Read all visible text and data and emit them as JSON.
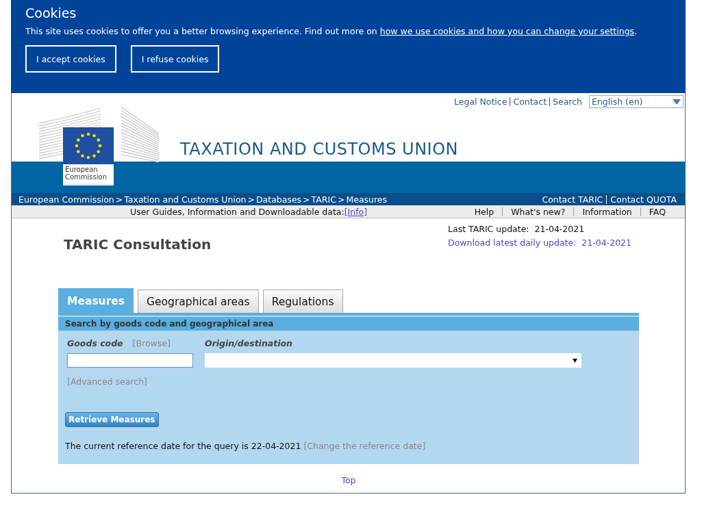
{
  "cookie_banner": {
    "title": "Cookies",
    "message": "This site uses cookies to offer you a better browsing experience. Find out more on",
    "link": "how we use cookies and how you can change your settings",
    "message_end": ".",
    "buttons": [
      "I accept cookies",
      "I refuse cookies"
    ]
  },
  "header": {
    "top_links": [
      "Legal Notice",
      "Contact",
      "Search"
    ],
    "language": "English (en)",
    "logo_text": "European Commission",
    "site_title": "TAXATION AND CUSTOMS UNION"
  },
  "breadcrumbs": [
    {
      "label": "European Commission",
      "separator": ">"
    },
    {
      "label": "Taxation and Customs Union",
      "separator": ">"
    },
    {
      "label": "Databases",
      "separator": ">"
    },
    {
      "label": "TARIC",
      "separator": ">"
    },
    {
      "label": "Measures"
    }
  ],
  "contact_links": [
    "Contact TARIC",
    "Contact QUOTA"
  ],
  "info_bar": {
    "text": "User Guides, Information and Downloadable data:",
    "link": "[Info]",
    "links": [
      "Help",
      "What's new?",
      "Information",
      "FAQ"
    ]
  },
  "page": {
    "title": "TARIC Consultation",
    "last_update_label": "Last TARIC update:",
    "last_update_date": "21-04-2021",
    "download_label": "Download latest daily update:",
    "download_date": "21-04-2021"
  },
  "tabs": [
    {
      "label": "Measures",
      "selected": true
    },
    {
      "label": "Geographical areas",
      "selected": false
    },
    {
      "label": "Regulations",
      "selected": false
    }
  ],
  "panel": {
    "heading": "Search by goods code and geographical area",
    "goods_code_label": "Goods code",
    "browse_link": "[Browse]",
    "origin_label": "Origin/destination",
    "advanced_link": "[Advanced search]",
    "retrieve_button": "Retrieve Measures",
    "reference_text": "The current reference date for the query is 22-04-2021",
    "change_link": "[Change the reference date]"
  },
  "footer_link": "Top"
}
